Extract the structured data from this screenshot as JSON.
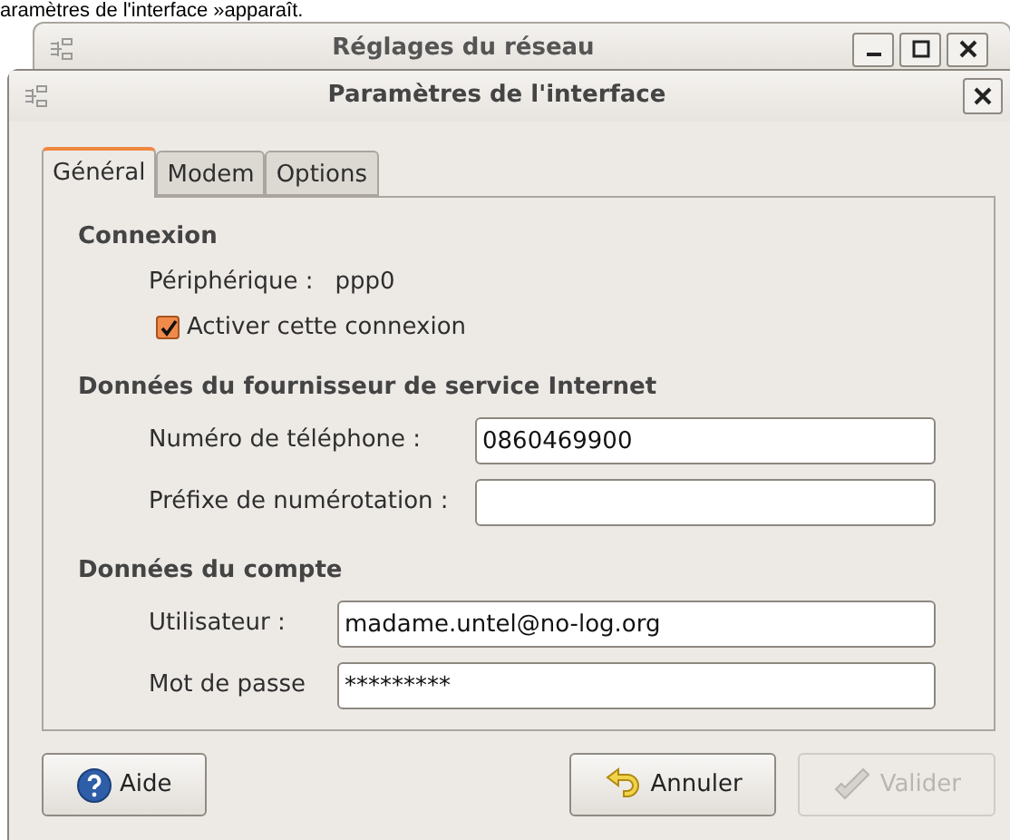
{
  "caption": "aramètres de l'interface »apparaît.",
  "back_window": {
    "title": "Réglages du réseau"
  },
  "dialog": {
    "title": "Paramètres de l'interface"
  },
  "tabs": [
    {
      "label": "Général",
      "selected": true
    },
    {
      "label": "Modem",
      "selected": false
    },
    {
      "label": "Options",
      "selected": false
    }
  ],
  "sections": [
    {
      "heading": "Connexion",
      "rows": [
        {
          "kind": "info",
          "label": "Périphérique :",
          "value": "ppp0"
        },
        {
          "kind": "checkbox",
          "label": "Activer cette connexion",
          "checked": true
        }
      ]
    },
    {
      "heading": "Données du fournisseur de service Internet",
      "rows": [
        {
          "kind": "field",
          "label": "Numéro de téléphone :",
          "value": "0860469900"
        },
        {
          "kind": "field",
          "label": "Préfixe de numérotation :",
          "value": ""
        }
      ]
    },
    {
      "heading": "Données du compte",
      "rows": [
        {
          "kind": "field",
          "label": "Utilisateur :",
          "value": "madame.untel@no-log.org"
        },
        {
          "kind": "field",
          "label": "Mot de passe",
          "value": "*********"
        }
      ]
    }
  ],
  "buttons": [
    {
      "kind": "help",
      "label": "Aide",
      "disabled": false
    },
    {
      "kind": "cancel",
      "label": "Annuler",
      "disabled": false
    },
    {
      "kind": "ok",
      "label": "Valider",
      "disabled": true
    }
  ]
}
